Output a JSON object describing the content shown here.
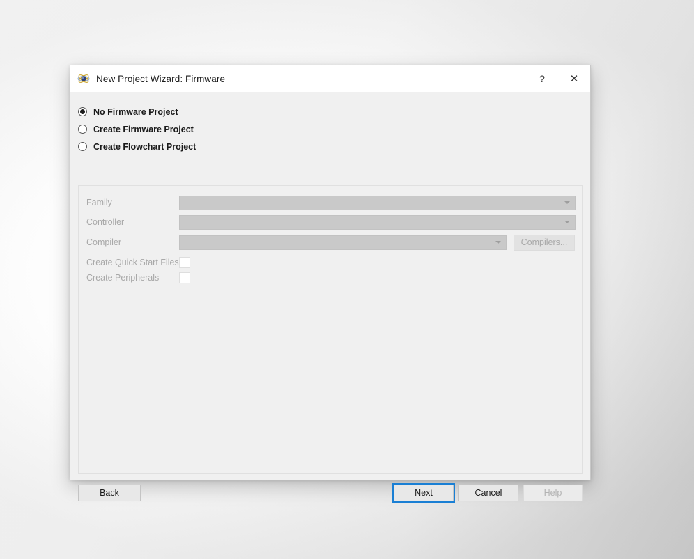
{
  "window": {
    "title": "New Project Wizard: Firmware",
    "icon": "atom-icon",
    "controls": {
      "help": "?",
      "close": "✕"
    }
  },
  "project_type": {
    "selected": "No Firmware Project",
    "options": [
      {
        "label": "No Firmware Project",
        "checked": true
      },
      {
        "label": "Create Firmware Project",
        "checked": false
      },
      {
        "label": "Create Flowchart Project",
        "checked": false
      }
    ]
  },
  "settings": {
    "family": {
      "label": "Family",
      "value": "",
      "enabled": false
    },
    "controller": {
      "label": "Controller",
      "value": "",
      "enabled": false
    },
    "compiler": {
      "label": "Compiler",
      "value": "",
      "enabled": false
    },
    "compilers_button": {
      "label": "Compilers...",
      "enabled": false
    },
    "quick_start": {
      "label": "Create Quick Start Files",
      "checked": false,
      "enabled": false
    },
    "peripherals": {
      "label": "Create Peripherals",
      "checked": false,
      "enabled": false
    }
  },
  "footer": {
    "back": {
      "label": "Back",
      "enabled": true
    },
    "next": {
      "label": "Next",
      "enabled": true,
      "focused": true
    },
    "cancel": {
      "label": "Cancel",
      "enabled": true
    },
    "help": {
      "label": "Help",
      "enabled": false
    }
  },
  "colors": {
    "dialog_bg": "#f0f0f0",
    "titlebar_bg": "#ffffff",
    "combo_disabled": "#c9c9c9",
    "focus_blue": "#1a7fd4",
    "disabled_text": "#a8a8a8",
    "background_accent": "#7ba9bb"
  }
}
